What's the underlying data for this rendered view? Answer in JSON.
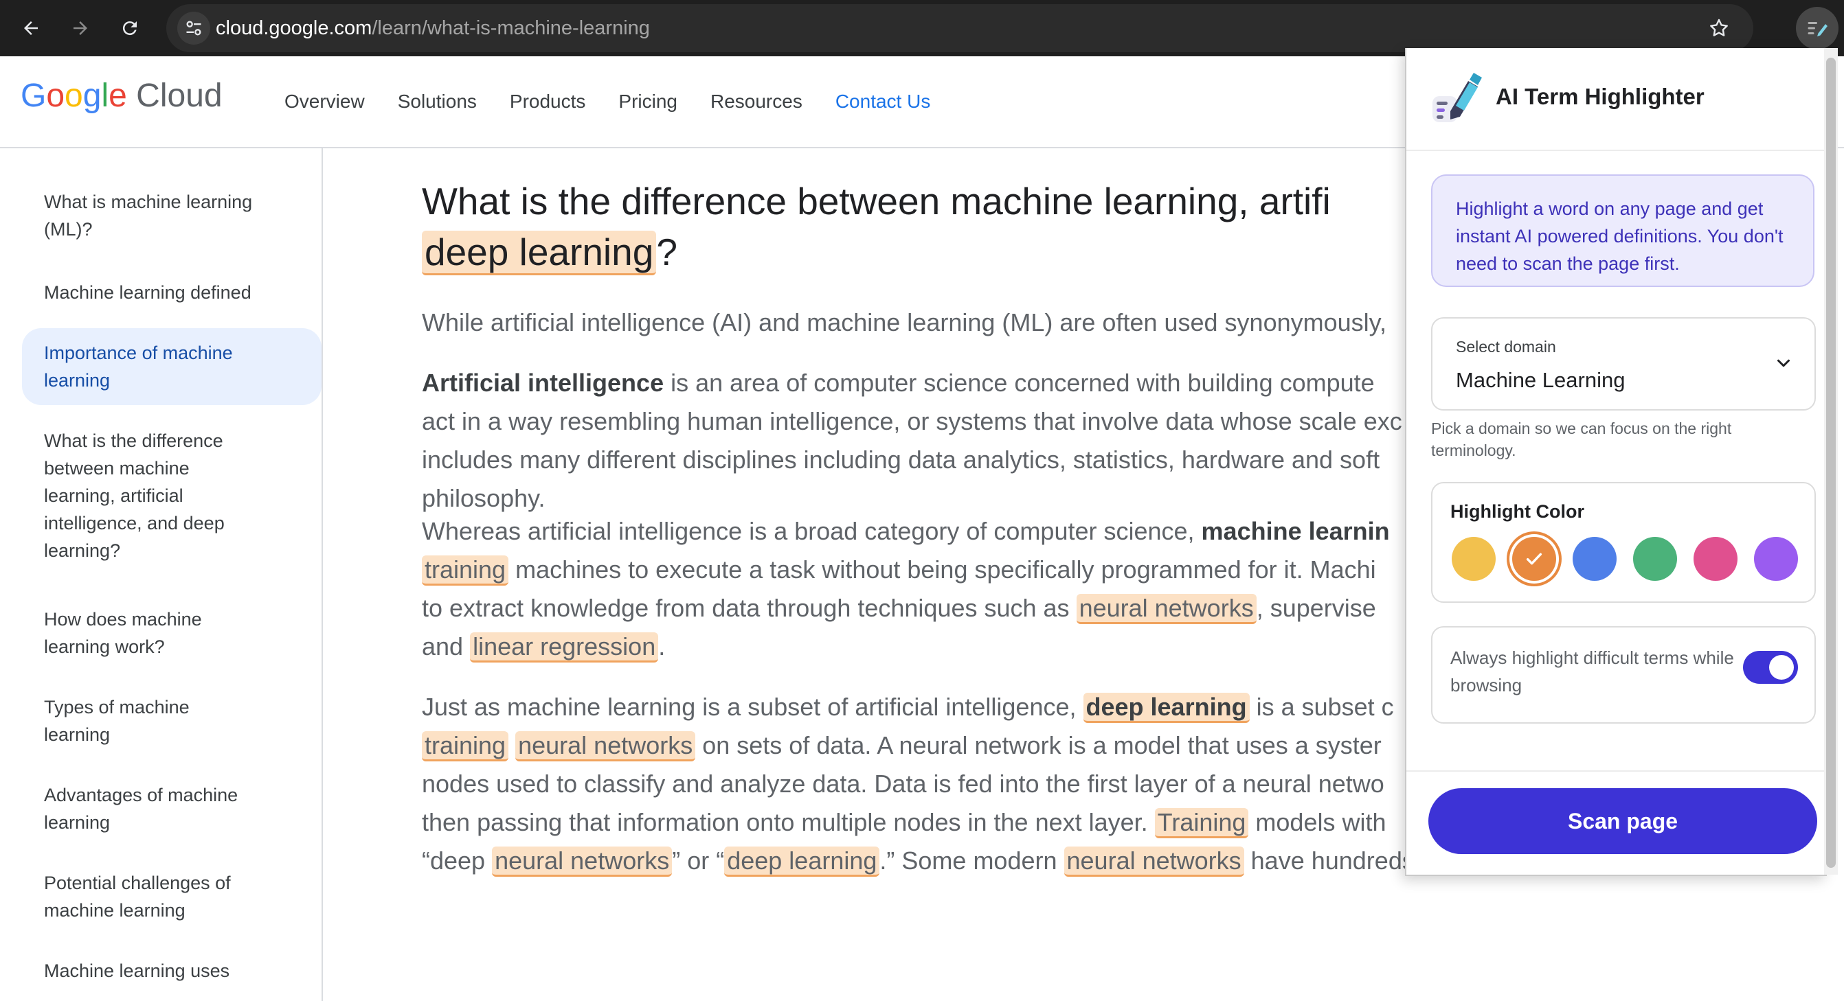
{
  "browser": {
    "url_host": "cloud.google.com",
    "url_path": "/learn/what-is-machine-learning"
  },
  "site": {
    "logo": {
      "google": "Google",
      "cloud": "Cloud"
    },
    "nav": [
      "Overview",
      "Solutions",
      "Products",
      "Pricing",
      "Resources",
      "Contact Us"
    ]
  },
  "sidebar": {
    "items": [
      {
        "line1": "What is machine learning",
        "line2": "(ML)?"
      },
      {
        "line1": "Machine learning defined"
      },
      {
        "line1": "Importance of machine",
        "line2": "learning",
        "active": true
      },
      {
        "line1": "What is the difference",
        "line2": "between machine",
        "line3": "learning, artificial",
        "line4": "intelligence, and deep",
        "line5": "learning?"
      },
      {
        "line1": "How does machine",
        "line2": "learning work?"
      },
      {
        "line1": "Types of machine",
        "line2": "learning"
      },
      {
        "line1": "Advantages of machine",
        "line2": "learning"
      },
      {
        "line1": "Potential challenges of",
        "line2": "machine learning"
      },
      {
        "line1": "Machine learning uses"
      }
    ]
  },
  "article": {
    "title_line1": "What is the difference between machine learning, artifi",
    "title_hl": "deep learning",
    "title_end": "?",
    "p1": "While artificial intelligence (AI) and machine learning (ML) are often used synonymously,",
    "p2_bold": "Artificial intelligence",
    "p2_l1": " is an area of computer science concerned with building compute",
    "p2_l2": "act in a way resembling human intelligence, or systems that involve data whose scale exc",
    "p2_l3": "includes many different disciplines including data analytics, statistics, hardware and soft",
    "p2_l4": "philosophy.",
    "p3_l1": "Whereas artificial intelligence is a broad category of computer science, ",
    "p3_l1_bold": "machine learnin",
    "p3_hl_training": "training",
    "p3_l2": " machines to execute a task without being specifically programmed for it. Machi",
    "p3_l3a": "to extract knowledge from data through techniques such as ",
    "p3_hl_nn": "neural networks",
    "p3_l3b": ", supervise",
    "p3_l4a": "and ",
    "p3_hl_lr": "linear regression",
    "p3_l4b": ".",
    "p4_l1a": "Just as machine learning is a subset of artificial intelligence, ",
    "p4_hl_dl": "deep learning",
    "p4_l1b": " is a subset c",
    "p4_hl_training": "training",
    "p4_hl_nn": "neural networks",
    "p4_l2": " on sets of data. A neural network is a model that uses a syster",
    "p4_l3": "nodes used to classify and analyze data. Data is fed into the first layer of a neural netwo",
    "p4_l4a": "then passing that information onto multiple nodes in the next layer. ",
    "p4_hl_training2": "Training",
    "p4_l4b": " models with",
    "p4_l5a": "“deep ",
    "p4_hl_nn2": "neural networks",
    "p4_l5b": "” or “",
    "p4_hl_dl2": "deep learning",
    "p4_l5c": ".” Some modern ",
    "p4_hl_nn3": "neural networks",
    "p4_l5d": " have hundreds or thousands of layers."
  },
  "popup": {
    "title": "AI Term Highlighter",
    "info_text": "Highlight a word on any page and get instant AI powered definitions. You don't need to scan the page first.",
    "domain_label": "Select domain",
    "domain_value": "Machine Learning",
    "domain_hint": "Pick a domain so we can focus on the right terminology.",
    "color_title": "Highlight Color",
    "colors": [
      "#f2c14e",
      "#e8893f",
      "#4f7fe8",
      "#4bb27a",
      "#e0508f",
      "#9a5cf0"
    ],
    "selected_color": "#e8893f",
    "toggle_label": "Always highlight difficult terms while browsing",
    "toggle_on": true,
    "scan_button": "Scan page"
  }
}
